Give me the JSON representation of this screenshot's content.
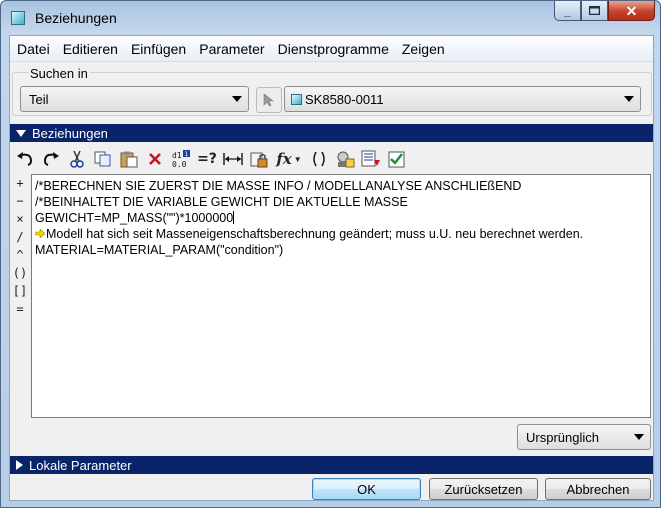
{
  "window": {
    "title": "Beziehungen"
  },
  "menu": [
    "Datei",
    "Editieren",
    "Einfügen",
    "Parameter",
    "Dienstprogramme",
    "Zeigen"
  ],
  "search": {
    "label": "Suchen in",
    "scope_value": "Teil",
    "model_value": "SK8580-0011"
  },
  "relations_section": {
    "title": "Beziehungen"
  },
  "toolbar_icons": [
    "undo-icon",
    "redo-icon",
    "cut-icon",
    "copy-icon",
    "paste-icon",
    "delete-icon",
    "show-values-icon",
    "evaluate-icon",
    "dimension-icon",
    "lock-units-icon",
    "function-icon",
    "parentheses-icon",
    "sort-icon",
    "verify-icon",
    "check-icon"
  ],
  "operators": [
    "+",
    "−",
    "×",
    "/",
    "^",
    "()",
    "[]",
    "="
  ],
  "editor": {
    "lines": [
      "/*BERECHNEN SIE ZUERST DIE MASSE INFO / MODELLANALYSE ANSCHLIEßEND",
      "/*BEINHALTET DIE VARIABLE GEWICHT DIE AKTUELLE MASSE",
      "GEWICHT=MP_MASS(\"\")*1000000",
      "Modell hat sich seit Masseneigenschaftsberechnung geändert; muss u.U. neu berechnet werden.",
      "MATERIAL=MATERIAL_PARAM(\"condition\")"
    ],
    "warning_color": "#f5d400"
  },
  "value_display": {
    "selected": "Ursprünglich"
  },
  "local_params_section": {
    "title": "Lokale Parameter"
  },
  "buttons": {
    "ok": "OK",
    "reset": "Zurücksetzen",
    "cancel": "Abbrechen"
  },
  "colors": {
    "section_bar": "#0a246a",
    "close_button": "#c6412a"
  }
}
